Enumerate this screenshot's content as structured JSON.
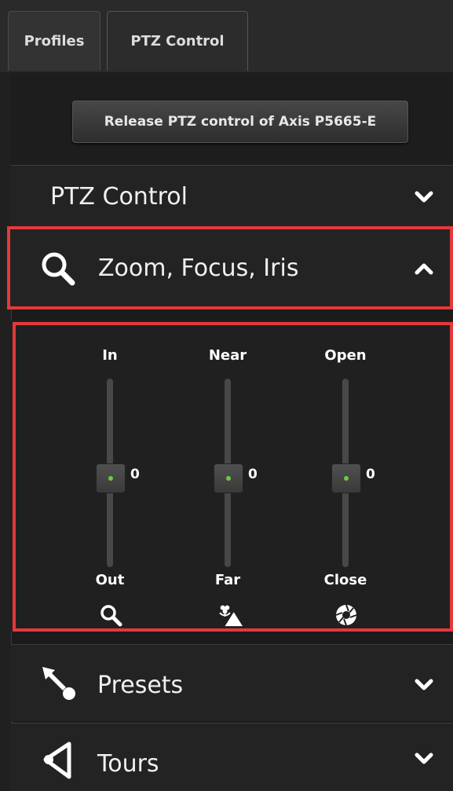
{
  "tabs": [
    {
      "label": "Profiles",
      "active": false
    },
    {
      "label": "PTZ Control",
      "active": true
    }
  ],
  "release_button": "Release PTZ control of Axis P5665-E",
  "sections": {
    "ptz_control": {
      "label": "PTZ Control",
      "state": "collapsed",
      "icon": "chevron-down-icon"
    },
    "zoom_focus_iris": {
      "label": "Zoom, Focus, Iris",
      "state": "expanded",
      "icon": "magnifier-icon",
      "toggle_icon": "chevron-up-icon"
    },
    "presets": {
      "label": "Presets",
      "state": "collapsed",
      "icon": "preset-pointer-icon"
    },
    "tours": {
      "label": "Tours",
      "state": "collapsed",
      "icon": "tour-flag-icon"
    }
  },
  "sliders": [
    {
      "name": "Zoom",
      "top": "In",
      "bottom": "Out",
      "value": "0",
      "icon": "zoom-icon"
    },
    {
      "name": "Focus",
      "top": "Near",
      "bottom": "Far",
      "value": "0",
      "icon": "focus-flower-mountain-icon"
    },
    {
      "name": "Iris",
      "top": "Open",
      "bottom": "Close",
      "value": "0",
      "icon": "iris-aperture-icon"
    }
  ],
  "colors": {
    "highlight": "#e5383b",
    "accent_dot": "#6ccb41",
    "panel": "#232323"
  }
}
